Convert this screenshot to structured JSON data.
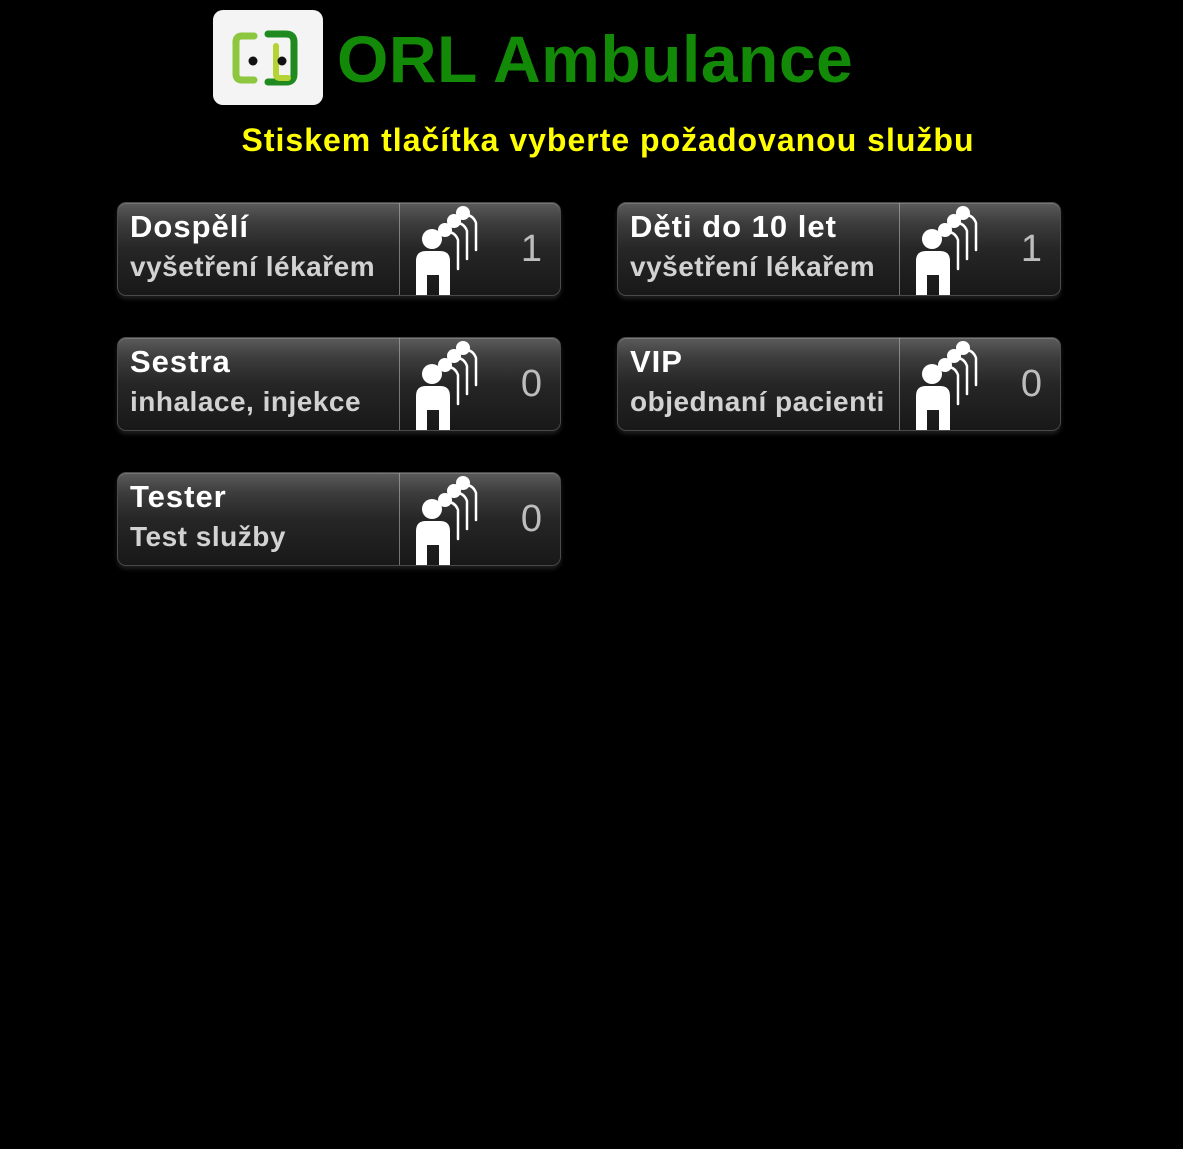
{
  "header": {
    "title": "ORL Ambulance",
    "logo_icon": "clinic-logo-icon",
    "title_color": "#138a07"
  },
  "instruction": "Stiskem tlačítka vyberte požadovanou službu",
  "instruction_color": "#ffff00",
  "services": [
    {
      "name": "Dospělí",
      "description": "vyšetření lékařem",
      "queue_count": "1",
      "icon": "queue-people-icon"
    },
    {
      "name": "Děti do 10 let",
      "description": "vyšetření lékařem",
      "queue_count": "1",
      "icon": "queue-people-icon"
    },
    {
      "name": "Sestra",
      "description": "inhalace, injekce",
      "queue_count": "0",
      "icon": "queue-people-icon"
    },
    {
      "name": "VIP",
      "description": "objednaní pacienti",
      "queue_count": "0",
      "icon": "queue-people-icon"
    },
    {
      "name": "Tester",
      "description": "Test služby",
      "queue_count": "0",
      "icon": "queue-people-icon"
    }
  ]
}
